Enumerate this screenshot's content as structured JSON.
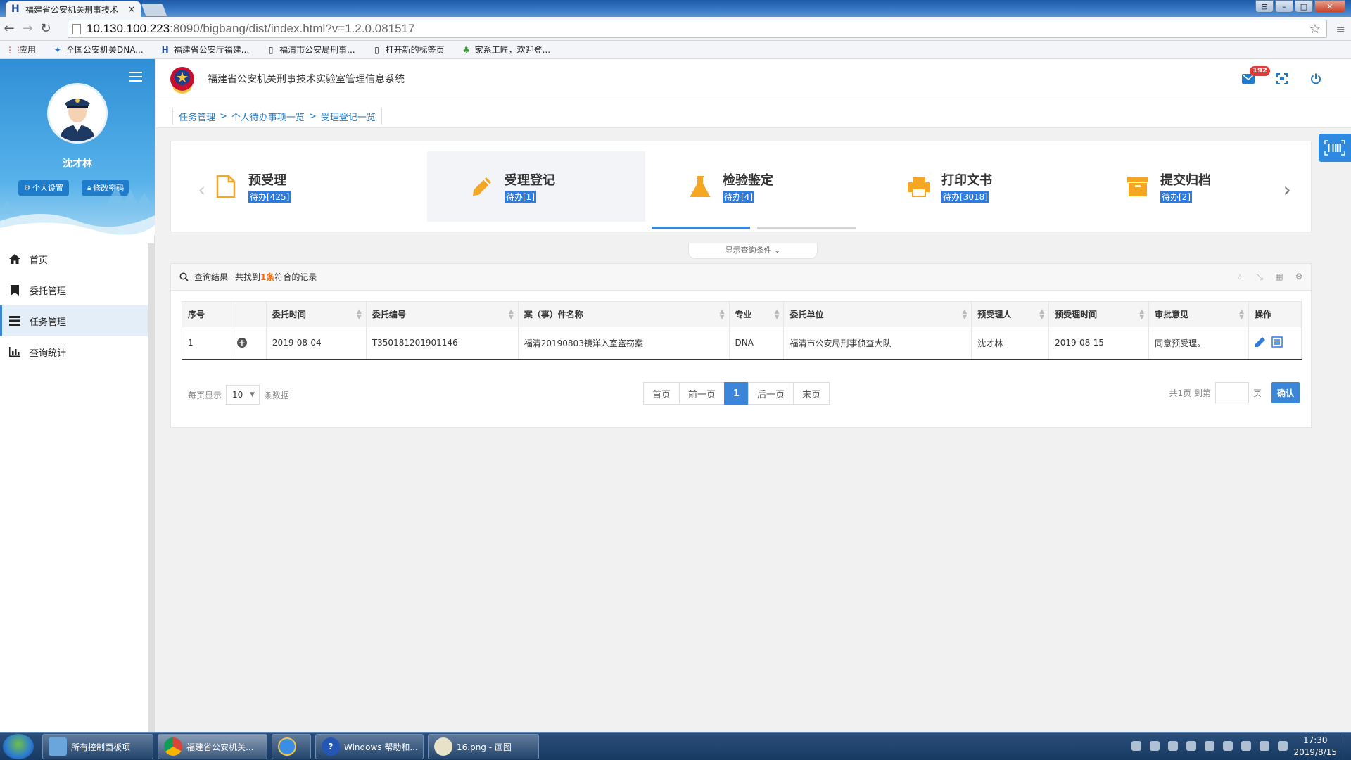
{
  "browser": {
    "tab_title": "福建省公安机关刑事技术",
    "tab_close": "×",
    "url_host": "10.130.100.223",
    "url_path": ":8090/bigbang/dist/index.html?v=1.2.0.081517",
    "bookmarks": [
      {
        "label": "应用",
        "icon": "apps-icon"
      },
      {
        "label": "全国公安机关DNA...",
        "icon": "dna-icon"
      },
      {
        "label": "福建省公安厅福建...",
        "icon": "h-logo-icon"
      },
      {
        "label": "福清市公安局刑事...",
        "icon": "page-icon"
      },
      {
        "label": "打开新的标签页",
        "icon": "page-icon"
      },
      {
        "label": "家系工匠，欢迎登...",
        "icon": "tree-icon"
      }
    ]
  },
  "app": {
    "system_title": "福建省公安机关刑事技术实验室管理信息系统",
    "mail_badge": "192",
    "user": {
      "name": "沈才林",
      "settings_label": "个人设置",
      "password_label": "修改密码"
    },
    "nav": [
      {
        "label": "首页",
        "icon": "home-icon",
        "active": false
      },
      {
        "label": "委托管理",
        "icon": "bookmark-icon",
        "active": false
      },
      {
        "label": "任务管理",
        "icon": "list-icon",
        "active": true
      },
      {
        "label": "查询统计",
        "icon": "bar-chart-icon",
        "active": false
      }
    ],
    "breadcrumb": [
      "任务管理",
      "个人待办事项一览",
      "受理登记一览"
    ],
    "steps": [
      {
        "title": "预受理",
        "count": "待办[425]",
        "icon": "document-icon"
      },
      {
        "title": "受理登记",
        "count": "待办[1]",
        "icon": "pencil-icon",
        "active": true
      },
      {
        "title": "检验鉴定",
        "count": "待办[4]",
        "icon": "flask-icon"
      },
      {
        "title": "打印文书",
        "count": "待办[3018]",
        "icon": "printer-icon"
      },
      {
        "title": "提交归档",
        "count": "待办[2]",
        "icon": "archive-icon"
      }
    ],
    "query_toggle": "显示查询条件",
    "results": {
      "label": "查询结果",
      "found_prefix": "共找到",
      "found_count": "1条",
      "found_suffix": "符合的记录"
    },
    "table": {
      "headers": [
        "序号",
        "",
        "委托时间",
        "委托编号",
        "案（事）件名称",
        "专业",
        "委托单位",
        "预受理人",
        "预受理时间",
        "审批意见",
        "操作"
      ],
      "rows": [
        [
          "1",
          "",
          "2019-08-04",
          "T350181201901146",
          "福清20190803镜洋入室盗窃案",
          "DNA",
          "福清市公安局刑事侦查大队",
          "沈才林",
          "2019-08-15",
          "同意预受理。",
          ""
        ]
      ]
    },
    "pagination": {
      "per_page_label": "每页显示",
      "per_page_value": "10",
      "per_page_suffix": "条数据",
      "first": "首页",
      "prev": "前一页",
      "current": "1",
      "next": "后一页",
      "last": "末页",
      "total_label": "共1页 到第",
      "page_suffix": "页",
      "confirm": "确认"
    }
  },
  "taskbar": {
    "items": [
      "所有控制面板项",
      "福建省公安机关...",
      "",
      "Windows 帮助和...",
      "16.png - 画图"
    ],
    "time": "17:30",
    "date": "2019/8/15"
  },
  "colors": {
    "accent": "#3b86d8",
    "step_icon": "#f5a623",
    "highlight": "#ff6600"
  }
}
